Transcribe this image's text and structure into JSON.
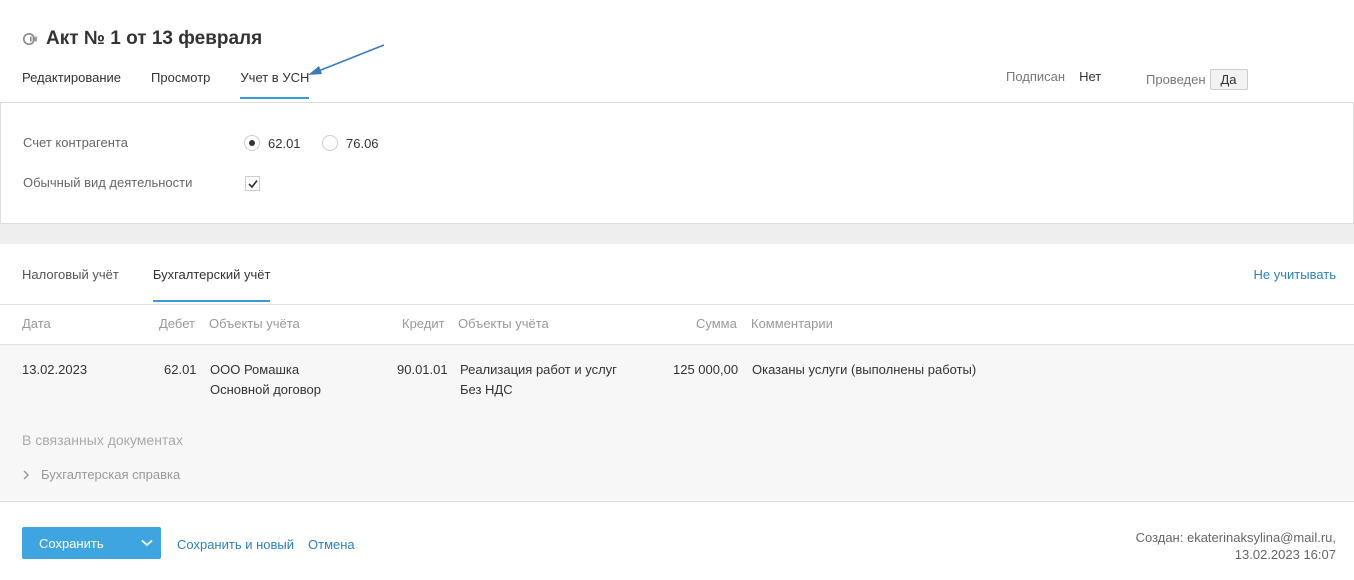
{
  "header": {
    "title": "Акт № 1 от 13 февраля",
    "tabs": [
      {
        "label": "Редактирование",
        "active": false
      },
      {
        "label": "Просмотр",
        "active": false
      },
      {
        "label": "Учет в УСН",
        "active": true
      }
    ],
    "signed": {
      "label": "Подписан",
      "value": "Нет"
    },
    "posted": {
      "label": "Проведен",
      "value": "Да"
    }
  },
  "form": {
    "account_label": "Счет контрагента",
    "account_options": [
      {
        "label": "62.01",
        "selected": true
      },
      {
        "label": "76.06",
        "selected": false
      }
    ],
    "activity_label": "Обычный вид деятельности",
    "activity_checked": true
  },
  "accounting": {
    "tabs": [
      {
        "label": "Налоговый учёт",
        "active": false
      },
      {
        "label": "Бухгалтерский учёт",
        "active": true
      }
    ],
    "ignore_link": "Не учитывать",
    "columns": [
      "Дата",
      "Дебет",
      "Объекты учёта",
      "Кредит",
      "Объекты учёта",
      "Сумма",
      "Комментарии"
    ],
    "rows": [
      {
        "date": "13.02.2023",
        "debit": "62.01",
        "debit_objects": [
          "ООО Ромашка",
          "Основной договор"
        ],
        "credit": "90.01.01",
        "credit_objects": [
          "Реализация работ и услуг",
          "Без НДС"
        ],
        "amount": "125 000,00",
        "comment": "Оказаны услуги (выполнены работы)"
      }
    ],
    "related_title": "В связанных документах",
    "related_item": "Бухгалтерская справка"
  },
  "footer": {
    "save": "Сохранить",
    "save_new": "Сохранить и новый",
    "cancel": "Отмена",
    "created_line1": "Создан: ekaterinaksylina@mail.ru,",
    "created_line2": "13.02.2023 16:07"
  },
  "colors": {
    "accent": "#3a9ad9",
    "button": "#3ea5e0",
    "link": "#2b7fc0",
    "annotation_arrow": "#3a7bbf"
  }
}
